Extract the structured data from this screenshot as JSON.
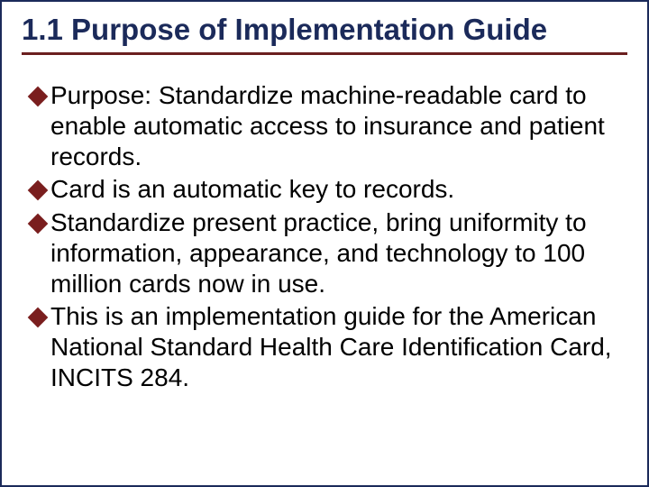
{
  "title": "1.1 Purpose of Implementation Guide",
  "bullets": [
    "Purpose:  Standardize machine-readable card to enable automatic access to insurance and patient records.",
    "Card is an automatic key to records.",
    "Standardize present practice, bring uniformity to information, appearance, and technology to 100 million cards now in use.",
    "This is an implementation guide for the American National Standard Health Care Identification Card, INCITS 284."
  ]
}
